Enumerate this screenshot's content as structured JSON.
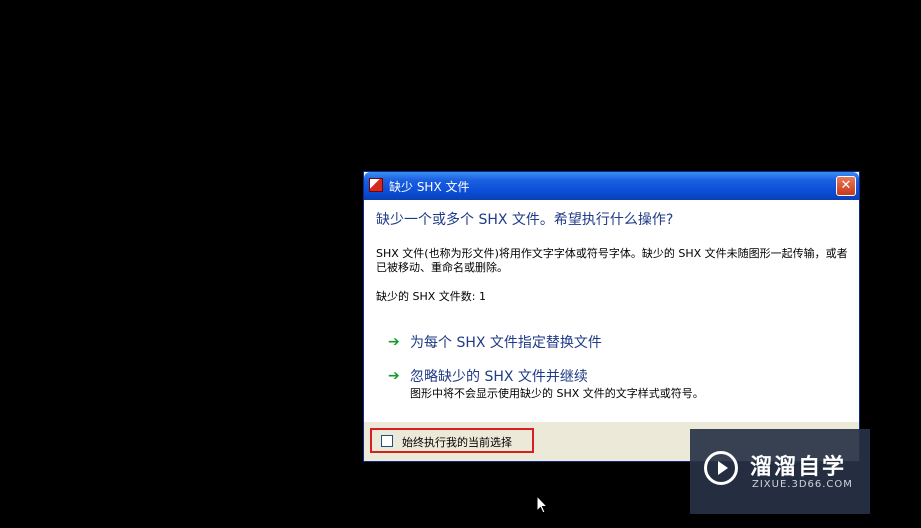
{
  "dialog": {
    "title": "缺少 SHX 文件",
    "close_label": "✕",
    "heading": "缺少一个或多个 SHX 文件。希望执行什么操作?",
    "description": "SHX 文件(也称为形文件)将用作文字字体或符号字体。缺少的 SHX 文件未随图形一起传输，或者已被移动、重命名或删除。",
    "missing_count": "缺少的 SHX 文件数: 1",
    "options": [
      {
        "label": "为每个 SHX 文件指定替换文件",
        "sub": ""
      },
      {
        "label": "忽略缺少的 SHX 文件并继续",
        "sub": "图形中将不会显示使用缺少的 SHX 文件的文字样式或符号。"
      }
    ],
    "always_label": "始终执行我的当前选择"
  },
  "watermark": {
    "title": "溜溜自学",
    "subtitle": "ZIXUE.3D66.COM"
  },
  "colors": {
    "titlebar": "#0b4ed8",
    "heading_text": "#1f3b87",
    "arrow": "#1a9a2a",
    "highlight_border": "#d42020",
    "footer_bg": "#ece9d8"
  }
}
